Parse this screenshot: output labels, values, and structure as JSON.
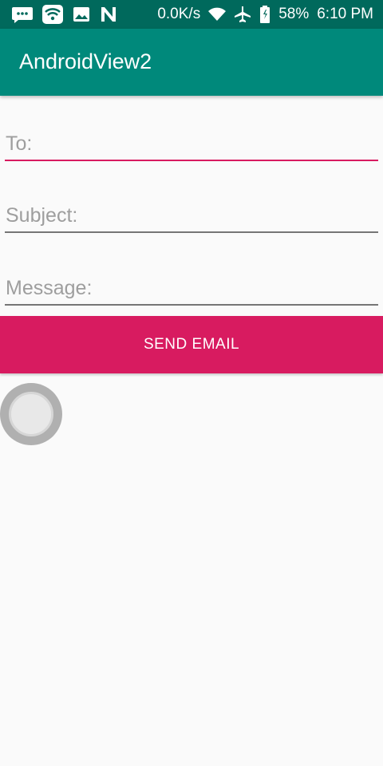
{
  "status_bar": {
    "left_icons": [
      "message-icon",
      "wifi-box-icon",
      "image-icon",
      "n-logo-icon"
    ],
    "network_speed": "0.0K/s",
    "battery_percent": "58%",
    "time": "6:10 PM",
    "right_icons": [
      "wifi-icon",
      "airplane-icon",
      "battery-icon"
    ]
  },
  "app_bar": {
    "title": "AndroidView2"
  },
  "form": {
    "to_placeholder": "To:",
    "to_value": "",
    "subject_placeholder": "Subject:",
    "subject_value": "",
    "message_placeholder": "Message:",
    "message_value": "",
    "send_label": "SEND EMAIL"
  },
  "colors": {
    "status_bar": "#00695c",
    "app_bar": "#00897b",
    "accent": "#d81b60"
  }
}
